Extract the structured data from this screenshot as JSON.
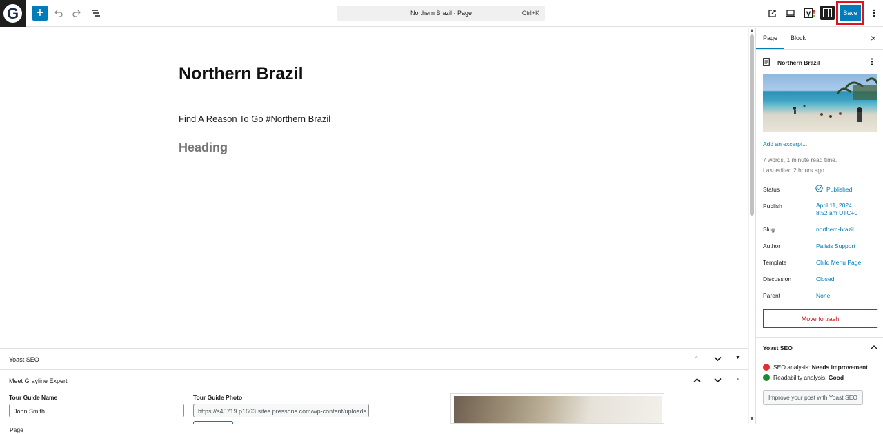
{
  "topbar": {
    "logo_letter": "G",
    "add_symbol": "+",
    "command": {
      "title": "Northern Brazil · Page",
      "shortcut": "Ctrl+K"
    },
    "save_label": "Save",
    "yoast_letter": "y",
    "icons": [
      "add-icon",
      "undo-icon",
      "redo-icon",
      "list-view-icon",
      "external-link-icon",
      "desktop-preview-icon",
      "yoast-icon",
      "sidebar-toggle-icon",
      "more-vertical-icon"
    ]
  },
  "content": {
    "title": "Northern Brazil",
    "paragraph": "Find A Reason To Go #Northern Brazil",
    "heading_placeholder": "Heading"
  },
  "metaboxes": {
    "yoast": {
      "label": "Yoast SEO"
    },
    "grayline": {
      "label": "Meet Grayline Expert",
      "guide_name_label": "Tour Guide Name",
      "guide_name_value": "John Smith",
      "guide_photo_label": "Tour Guide Photo",
      "guide_photo_value": "https://s45719.p1663.sites.pressdns.com/wp-content/uploads"
    }
  },
  "footer": {
    "breadcrumb": "Page"
  },
  "sidebar": {
    "tabs": [
      "Page",
      "Block"
    ],
    "close_symbol": "×",
    "page_name": "Northern Brazil",
    "excerpt_link": "Add an excerpt...",
    "stats": "7 words, 1 minute read time.",
    "last_edited": "Last edited 2 hours ago.",
    "rows": [
      {
        "label": "Status",
        "value": "Published"
      },
      {
        "label": "Publish",
        "value": "April 11, 2024",
        "value2": "8:52 am UTC+0"
      },
      {
        "label": "Slug",
        "value": "northern-brazil"
      },
      {
        "label": "Author",
        "value": "Palisis Support"
      },
      {
        "label": "Template",
        "value": "Child Menu Page"
      },
      {
        "label": "Discussion",
        "value": "Closed"
      },
      {
        "label": "Parent",
        "value": "None"
      }
    ],
    "trash_label": "Move to trash",
    "yoast": {
      "title": "Yoast SEO",
      "seo_prefix": "SEO analysis: ",
      "seo_value": "Needs improvement",
      "read_prefix": "Readability analysis: ",
      "read_value": "Good",
      "improve_label": "Improve your post with Yoast SEO"
    },
    "colors": {
      "accent": "#007cba",
      "danger": "#cc1818",
      "bad": "#dc3232",
      "good": "#1e8a2e"
    }
  }
}
